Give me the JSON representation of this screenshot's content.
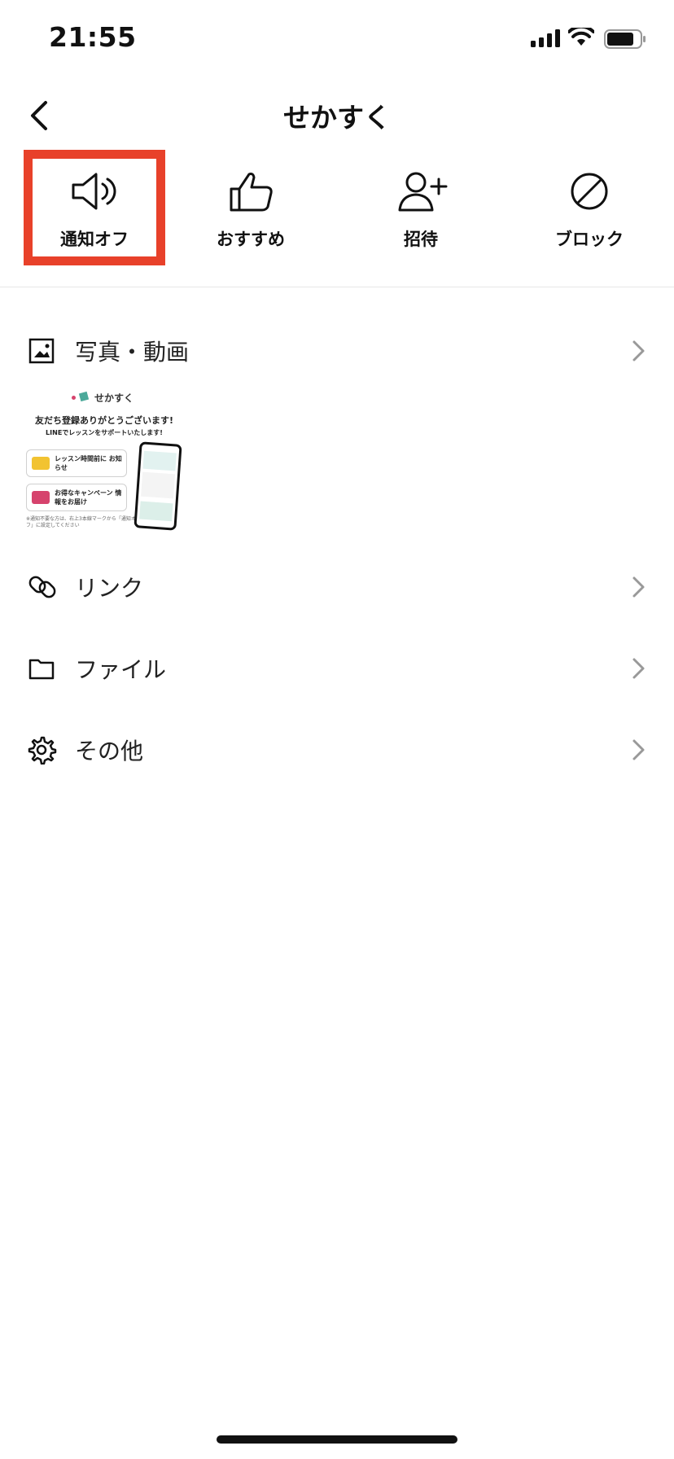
{
  "status_bar": {
    "time": "21:55",
    "icons": [
      "signal-icon",
      "wifi-icon",
      "battery-icon"
    ]
  },
  "nav": {
    "title": "せかすく",
    "back_icon": "chevron-left-icon"
  },
  "actions": [
    {
      "label": "通知オフ",
      "icon": "speaker-icon",
      "highlighted": true
    },
    {
      "label": "おすすめ",
      "icon": "thumbs-up-icon"
    },
    {
      "label": "招待",
      "icon": "add-user-icon"
    },
    {
      "label": "ブロック",
      "icon": "block-icon"
    }
  ],
  "highlight_color": "#e8412a",
  "menu": [
    {
      "label": "写真・動画",
      "icon": "image-icon"
    },
    {
      "label": "リンク",
      "icon": "link-icon"
    },
    {
      "label": "ファイル",
      "icon": "folder-icon"
    },
    {
      "label": "その他",
      "icon": "gear-icon"
    }
  ],
  "media_thumbnail": {
    "brand": "せかすく",
    "headline": "友だち登録ありがとうございます!",
    "subline": "LINEでレッスンをサポートいたします!",
    "card1": "レッスン時間前に お知らせ",
    "card2": "お得なキャンペーン 情報をお届け",
    "note": "※通知不要な方は、右上3本線マークから「通知オフ」に設定してください"
  }
}
